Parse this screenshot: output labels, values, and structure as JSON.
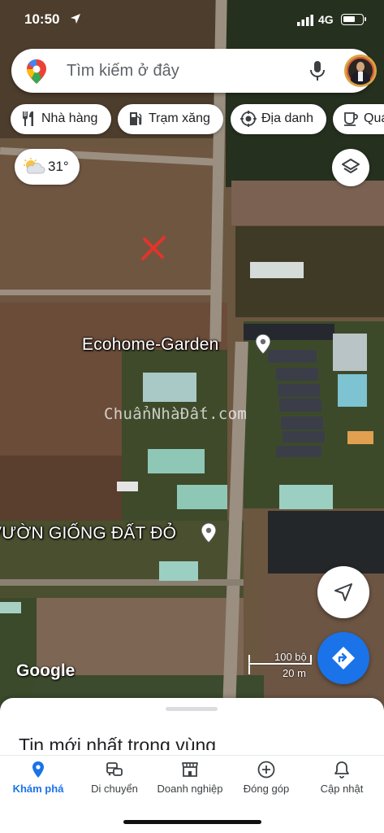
{
  "status_bar": {
    "time": "10:50",
    "network": "4G"
  },
  "search": {
    "placeholder": "Tìm kiếm ở đây"
  },
  "chips": [
    {
      "label": "Nhà hàng",
      "icon": "restaurant-icon"
    },
    {
      "label": "Trạm xăng",
      "icon": "gas-station-icon"
    },
    {
      "label": "Địa danh",
      "icon": "landmark-icon"
    },
    {
      "label": "Quán cà phê",
      "icon": "coffee-icon"
    }
  ],
  "weather": {
    "temperature": "31°",
    "icon": "partly-cloudy-icon"
  },
  "map": {
    "place_labels": [
      "Ecohome-Garden",
      "VƯỜN GIỐNG ĐẤT ĐỎ"
    ],
    "watermark": "ChuẩnNhàĐất.com",
    "attribution": "Google",
    "scale_feet": "100 bộ",
    "scale_meters": "20 m",
    "marker": "red-x-marker"
  },
  "sheet": {
    "title": "Tin mới nhất trong vùng"
  },
  "bottom_nav": [
    {
      "label": "Khám phá",
      "icon": "explore-pin-icon",
      "active": true
    },
    {
      "label": "Di chuyển",
      "icon": "commute-icon",
      "active": false
    },
    {
      "label": "Doanh nghiệp",
      "icon": "business-icon",
      "active": false
    },
    {
      "label": "Đóng góp",
      "icon": "contribute-icon",
      "active": false
    },
    {
      "label": "Cập nhật",
      "icon": "bell-icon",
      "active": false
    }
  ],
  "colors": {
    "accent": "#1a73e8",
    "marker": "#e5332a"
  }
}
